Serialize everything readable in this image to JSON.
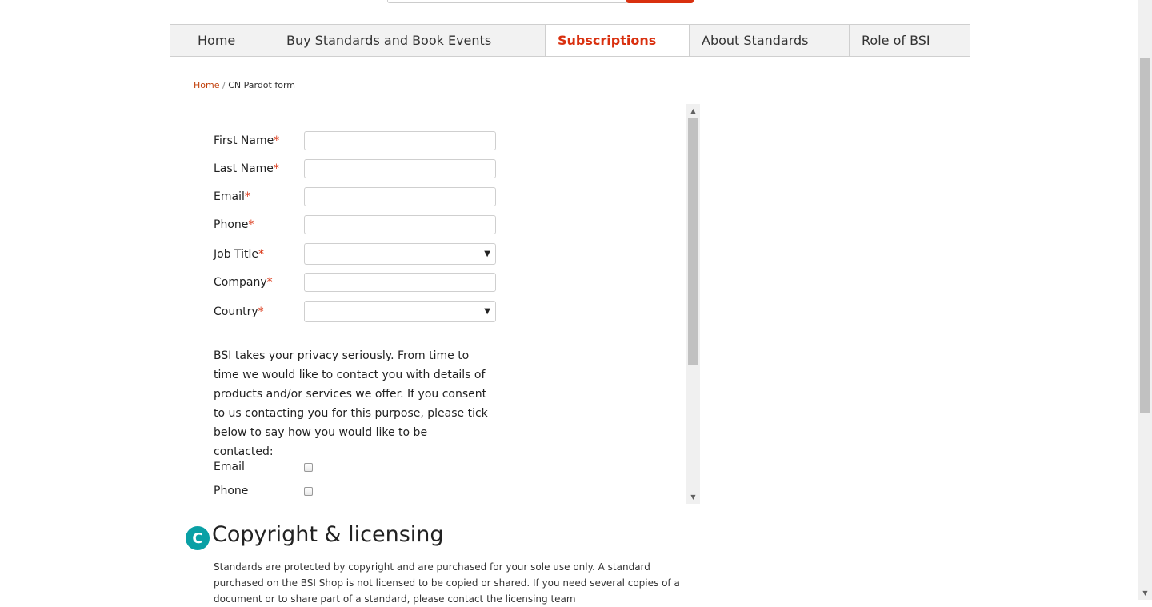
{
  "nav": {
    "items": [
      {
        "label": "Home",
        "active": false
      },
      {
        "label": "Buy Standards and Book Events",
        "active": false
      },
      {
        "label": "Subscriptions",
        "active": true
      },
      {
        "label": "About Standards",
        "active": false
      },
      {
        "label": "Role of BSI",
        "active": false
      }
    ]
  },
  "breadcrumb": {
    "home": "Home",
    "separator": "/",
    "current": "CN Pardot form"
  },
  "form": {
    "required_mark": "*",
    "fields": {
      "first_name": "First Name",
      "last_name": "Last Name",
      "email": "Email",
      "phone": "Phone",
      "job_title": "Job Title",
      "company": "Company",
      "country": "Country"
    },
    "dropdown_arrow": "▼",
    "privacy_text": "BSI takes your privacy seriously. From time to time we would like to contact you with details of products and/or services we offer. If you consent to us contacting you for this purpose, please tick below to say how you would like to be contacted:",
    "consent": {
      "email_label": "Email",
      "phone_label": "Phone"
    }
  },
  "copyright": {
    "badge": "C",
    "title": "Copyright & licensing",
    "text": "Standards are protected by copyright and are purchased for your sole use only. A standard purchased on the BSI Shop is not licensed to be copied or shared. If you need several copies of a document or to share part of a standard, please contact the licensing team"
  },
  "colors": {
    "accent": "#d9300f",
    "badge": "#0aa0a5"
  }
}
